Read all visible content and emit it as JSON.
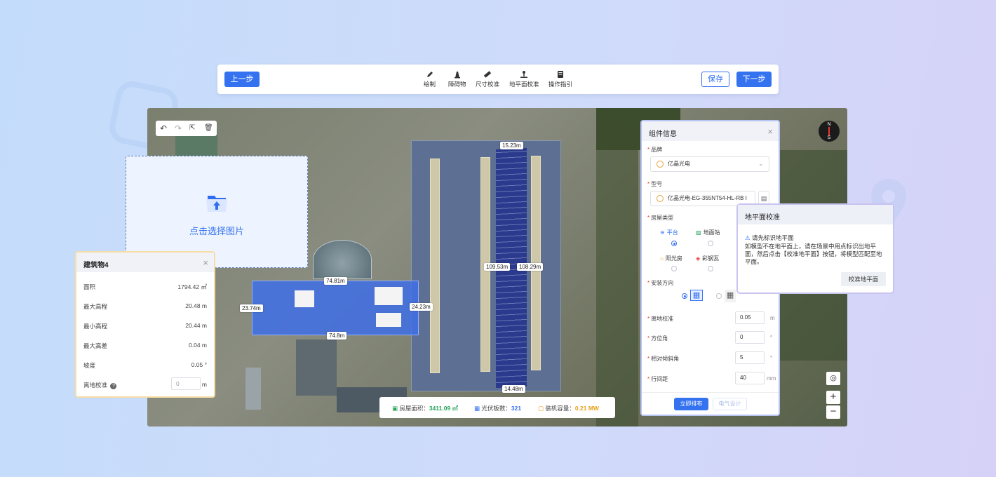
{
  "toolbar": {
    "prev_label": "上一步",
    "save_label": "保存",
    "next_label": "下一步",
    "tools": [
      {
        "label": "绘制",
        "icon": "pen-icon"
      },
      {
        "label": "障碍物",
        "icon": "obstacle-icon"
      },
      {
        "label": "尺寸校准",
        "icon": "ruler-icon"
      },
      {
        "label": "地平面校准",
        "icon": "ground-level-icon"
      },
      {
        "label": "操作指引",
        "icon": "guide-icon"
      }
    ]
  },
  "upload": {
    "label": "点击选择图片"
  },
  "building": {
    "title": "建筑物4",
    "rows": [
      {
        "label": "面积",
        "value": "1794.42 ㎡"
      },
      {
        "label": "最大高程",
        "value": "20.48 m"
      },
      {
        "label": "最小高程",
        "value": "20.44 m"
      },
      {
        "label": "最大高差",
        "value": "0.04 m"
      },
      {
        "label": "坡度",
        "value": "0.05 °"
      }
    ],
    "ground_label": "离地校准",
    "ground_value": "0",
    "ground_unit": "m"
  },
  "map": {
    "dims": [
      "15.23m",
      "109.53m",
      "108.29m",
      "14.48m",
      "74.81m",
      "23.74m",
      "24.23m",
      "74.8m"
    ],
    "compass": {
      "n": "N",
      "s": "S"
    },
    "zoom_in": "+",
    "zoom_out": "−"
  },
  "component": {
    "title": "组件信息",
    "brand_label": "品牌",
    "brand_value": "亿晶光电",
    "model_label": "型号",
    "model_value": "亿晶光电-EG-355NT54-HL-RB I",
    "roof_type_label": "房屋类型",
    "roof_types": [
      "平台",
      "地面站",
      "阳光房",
      "彩钢瓦"
    ],
    "orientation_label": "安装方向",
    "fields": [
      {
        "label": "离地校准",
        "value": "0.05",
        "unit": "m"
      },
      {
        "label": "方位角",
        "value": "0",
        "unit": "°"
      },
      {
        "label": "相对倾斜角",
        "value": "5",
        "unit": "°"
      },
      {
        "label": "行间距",
        "value": "40",
        "unit": "mm"
      }
    ],
    "arrange_label": "立即排布",
    "electric_label": "电气设计"
  },
  "ground_calib": {
    "title": "地平面校准",
    "warning": "请先标识地平面",
    "text": "如模型不在地平面上，请在场景中用点标识出地平面，然后点击【校准地平面】按钮，将模型匹配至地平面。",
    "button": "校准地平面"
  },
  "stats": {
    "area_label": "房屋面积：",
    "area_value": "3411.09 ㎡",
    "panels_label": "光伏板数：",
    "panels_value": "321",
    "capacity_label": "装机容量：",
    "capacity_value": "0.21 MW",
    "colors": {
      "area": "#27a35a",
      "panels": "#3572f0",
      "capacity": "#e8a019"
    }
  }
}
